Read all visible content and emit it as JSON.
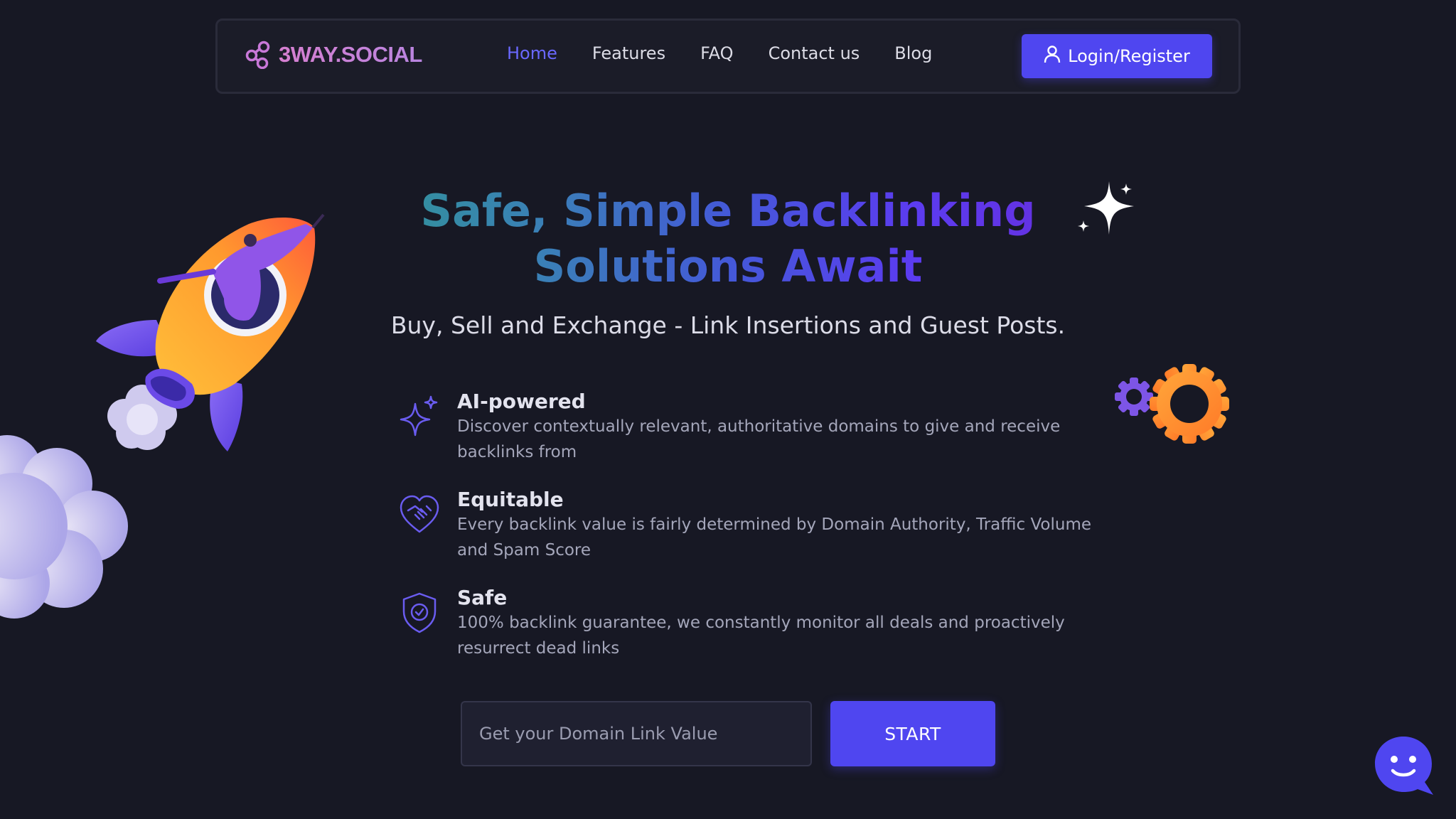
{
  "brand": {
    "name": "3WAY.SOCIAL",
    "icon": "share-nodes-icon"
  },
  "nav": {
    "items": [
      {
        "label": "Home",
        "active": true
      },
      {
        "label": "Features",
        "active": false
      },
      {
        "label": "FAQ",
        "active": false
      },
      {
        "label": "Contact us",
        "active": false
      },
      {
        "label": "Blog",
        "active": false
      }
    ],
    "login_label": "Login/Register",
    "login_icon": "user-icon"
  },
  "hero": {
    "title": "Safe, Simple Backlinking Solutions Await",
    "subtitle": "Buy, Sell and Exchange - Link Insertions and Guest Posts."
  },
  "features": [
    {
      "icon": "sparkle-icon",
      "title": "AI-powered",
      "description": "Discover contextually relevant, authoritative domains to give and receive backlinks from"
    },
    {
      "icon": "heart-handshake-icon",
      "title": "Equitable",
      "description": "Every backlink value is fairly determined by Domain Authority, Traffic Volume and Spam Score"
    },
    {
      "icon": "shield-check-icon",
      "title": "Safe",
      "description": "100% backlink guarantee, we constantly monitor all deals and proactively resurrect dead links"
    }
  ],
  "form": {
    "placeholder": "Get your Domain Link Value",
    "button_label": "START"
  },
  "colors": {
    "background": "#171824",
    "accent": "#4f46f0",
    "active_link": "#6a68ff"
  }
}
